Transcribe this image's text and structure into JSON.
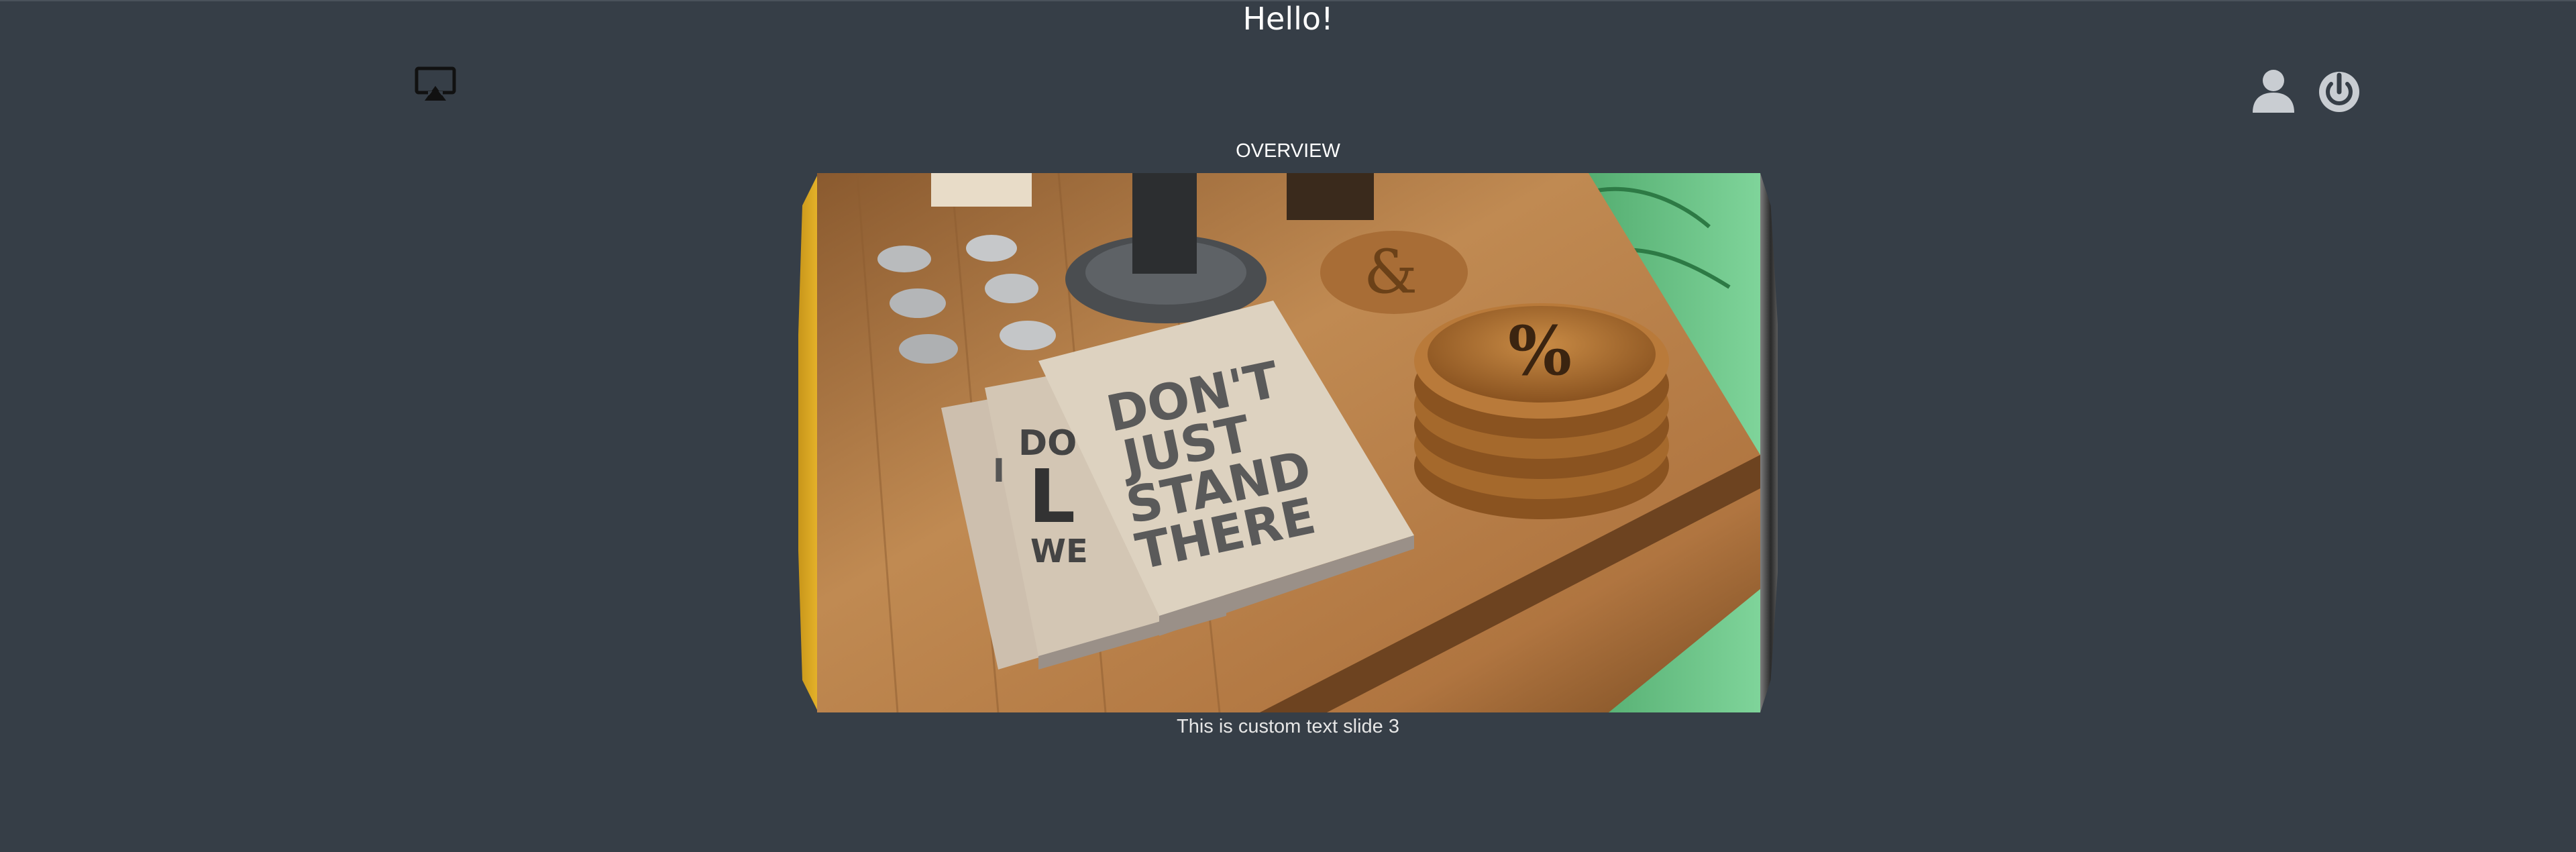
{
  "header": {
    "greeting": "Hello!",
    "cast_icon": "airplay-icon",
    "user_icon": "user-icon",
    "power_icon": "power-icon"
  },
  "carousel": {
    "title": "OVERVIEW",
    "active_slide": {
      "caption": "This is custom text slide 3",
      "notebook_text": [
        "DON'T",
        "JUST",
        "STAND",
        "THERE"
      ],
      "coaster_text": "%"
    }
  },
  "colors": {
    "background": "#363e47",
    "icon_light": "#c9cdd2",
    "icon_dark": "#111111",
    "text": "#ffffff"
  }
}
